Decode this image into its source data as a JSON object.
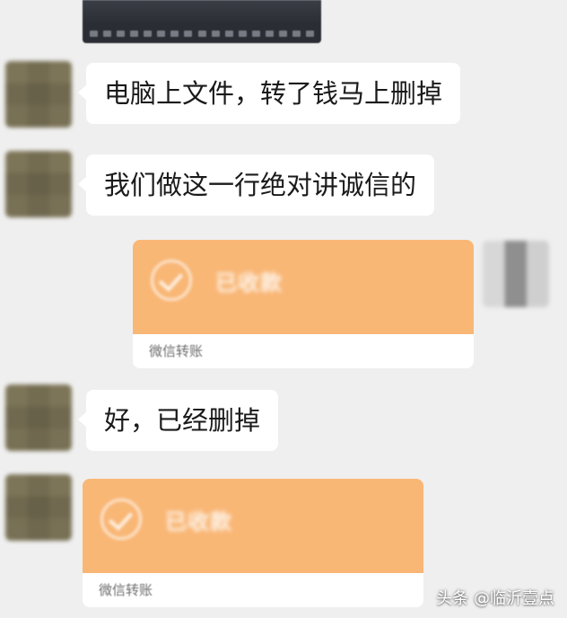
{
  "messages": [
    {
      "side": "left",
      "type": "text",
      "text": "电脑上文件，转了钱马上删掉"
    },
    {
      "side": "left",
      "type": "text",
      "text": "我们做这一行绝对讲诚信的"
    },
    {
      "side": "right",
      "type": "transfer",
      "amount": "已收款",
      "note": "微信转账"
    },
    {
      "side": "left",
      "type": "text",
      "text": "好，已经删掉"
    },
    {
      "side": "left",
      "type": "transfer",
      "amount": "已收款",
      "note": "微信转账"
    }
  ],
  "watermark": "头条 @临沂壹点",
  "colors": {
    "background": "#efefef",
    "bubble": "#ffffff",
    "transfer": "#f9b776"
  },
  "icons": {
    "transfer": "check-circle-icon"
  }
}
